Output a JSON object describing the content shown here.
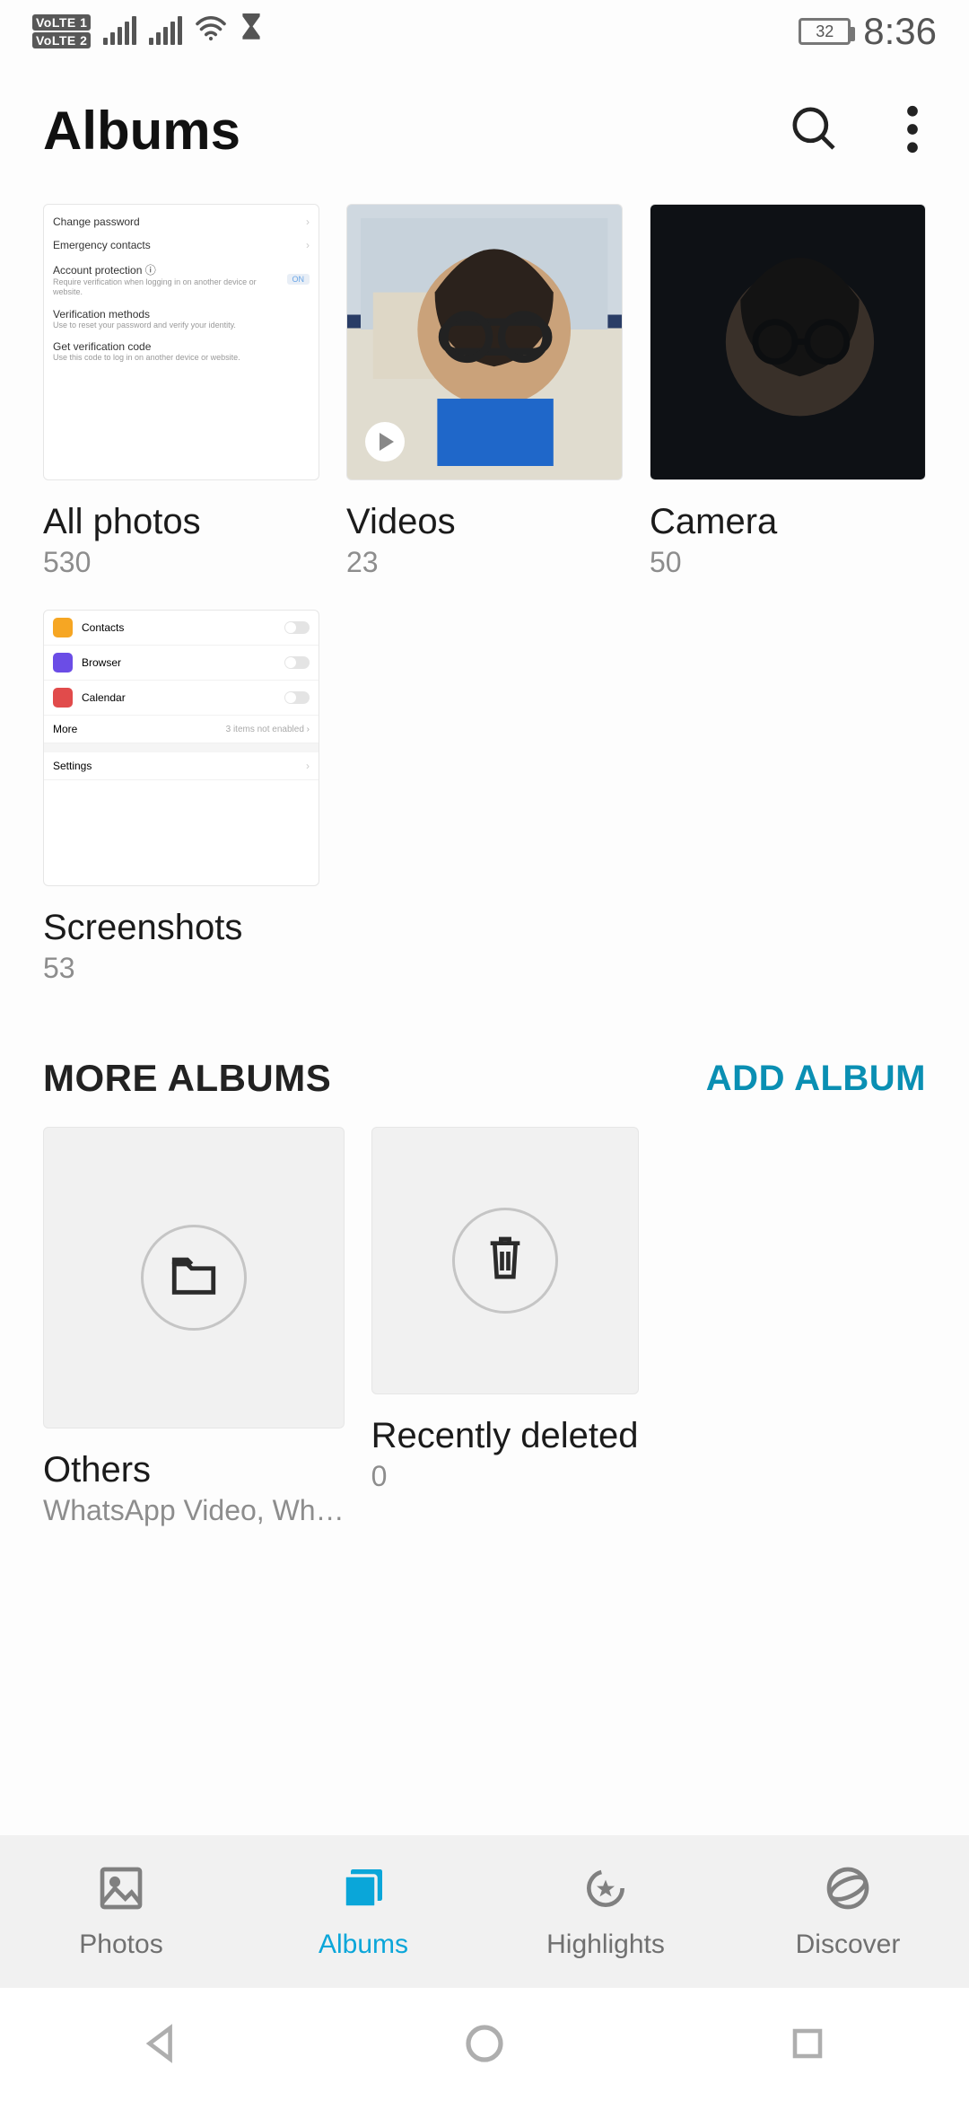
{
  "status": {
    "volte1": "VoLTE 1",
    "volte2": "VoLTE 2",
    "battery": "32",
    "time": "8:36"
  },
  "header": {
    "title": "Albums"
  },
  "albums": [
    {
      "id": "all",
      "title": "All photos",
      "count": "530"
    },
    {
      "id": "videos",
      "title": "Videos",
      "count": "23"
    },
    {
      "id": "camera",
      "title": "Camera",
      "count": "50"
    },
    {
      "id": "screenshots",
      "title": "Screenshots",
      "count": "53"
    }
  ],
  "thumb_all_rows": {
    "r0": "Change password",
    "r1": "Emergency contacts",
    "r2": "Account protection",
    "r2s": "Require verification when logging in on another device or website.",
    "r2b": "ON",
    "r3": "Verification methods",
    "r3s": "Use to reset your password and verify your identity.",
    "r4": "Get verification code",
    "r4s": "Use this code to log in on another device or website."
  },
  "thumb_sc_rows": {
    "r0": "Contacts",
    "r1": "Browser",
    "r2": "Calendar",
    "more": "More",
    "more_r": "3 items not enabled",
    "settings": "Settings"
  },
  "more_section": {
    "title": "MORE ALBUMS",
    "action": "ADD ALBUM"
  },
  "more_albums": [
    {
      "id": "others",
      "title": "Others",
      "subtitle": "WhatsApp Video, Wh…"
    },
    {
      "id": "trash",
      "title": "Recently deleted",
      "subtitle": "0"
    }
  ],
  "tabs": {
    "photos": "Photos",
    "albums": "Albums",
    "highlights": "Highlights",
    "discover": "Discover"
  }
}
